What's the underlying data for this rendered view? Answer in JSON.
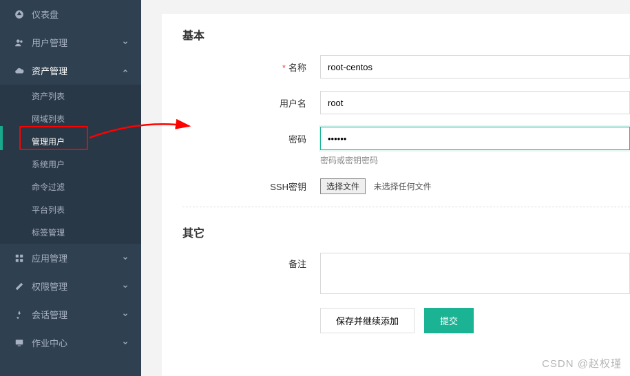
{
  "sidebar": {
    "items": [
      {
        "label": "仪表盘",
        "icon": "dashboard-icon",
        "expandable": false
      },
      {
        "label": "用户管理",
        "icon": "users-icon",
        "expandable": true,
        "expanded": false
      },
      {
        "label": "资产管理",
        "icon": "cloud-icon",
        "expandable": true,
        "expanded": true,
        "children": [
          {
            "label": "资产列表"
          },
          {
            "label": "网域列表"
          },
          {
            "label": "管理用户",
            "active": true
          },
          {
            "label": "系统用户"
          },
          {
            "label": "命令过滤"
          },
          {
            "label": "平台列表"
          },
          {
            "label": "标签管理"
          }
        ]
      },
      {
        "label": "应用管理",
        "icon": "grid-icon",
        "expandable": true,
        "expanded": false
      },
      {
        "label": "权限管理",
        "icon": "edit-icon",
        "expandable": true,
        "expanded": false
      },
      {
        "label": "会话管理",
        "icon": "rocket-icon",
        "expandable": true,
        "expanded": false
      },
      {
        "label": "作业中心",
        "icon": "monitor-icon",
        "expandable": true,
        "expanded": false
      }
    ]
  },
  "form": {
    "section_basic": "基本",
    "section_other": "其它",
    "name_label": "名称",
    "name_value": "root-centos",
    "username_label": "用户名",
    "username_value": "root",
    "password_label": "密码",
    "password_value": "••••••",
    "password_help": "密码或密钥密码",
    "sshkey_label": "SSH密钥",
    "file_button": "选择文件",
    "file_status": "未选择任何文件",
    "remark_label": "备注",
    "save_continue": "保存并继续添加",
    "submit": "提交"
  },
  "watermark": "CSDN @赵权瑾"
}
